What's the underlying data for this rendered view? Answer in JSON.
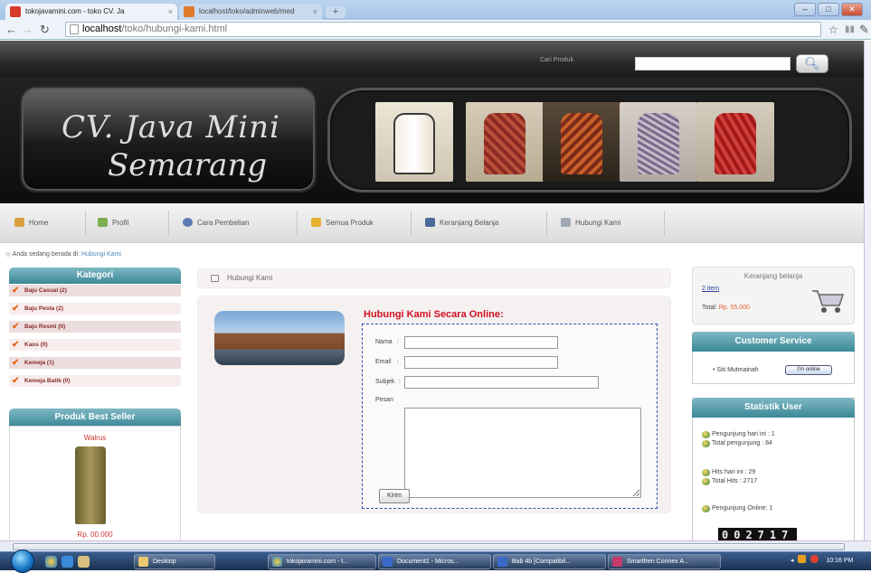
{
  "browser": {
    "tabs": [
      {
        "label": "tokojavamini.com - toko CV. Jа"
      },
      {
        "label": "localhost/toko/adminweb/med"
      }
    ],
    "url_host": "localhost",
    "url_path": "/toko/hubungi-kami.html",
    "new_tab": "+",
    "win_min": "–",
    "win_max": "□",
    "win_close": "✕"
  },
  "header": {
    "search_label": "Cari Produk",
    "search_value": "",
    "logo_line1": "CV. Java Mini",
    "logo_line2": "Semarang"
  },
  "nav": {
    "items": [
      {
        "label": "Home",
        "icon": "home-icon"
      },
      {
        "label": "Profil",
        "icon": "profile-icon"
      },
      {
        "label": "Cara Pembelian",
        "icon": "help-icon"
      },
      {
        "label": "Semua Produk",
        "icon": "star-icon"
      },
      {
        "label": "Keranjang Belanja",
        "icon": "cart-icon"
      },
      {
        "label": "Hubungi Kami",
        "icon": "contact-icon"
      }
    ]
  },
  "breadcrumb": {
    "prefix": "Anda sedang berada di:",
    "current": "Hubungi Kami"
  },
  "left": {
    "kategori_title": "Kategori",
    "categories": [
      "Baju Casual (2)",
      "Baju Pesta (2)",
      "Baju Resmi (0)",
      "Kaos (0)",
      "Kemeja (1)",
      "Kemeja Batik (0)"
    ],
    "best_title": "Produk Best Seller",
    "best_name": "Walrus",
    "best_price": "Rp. 00.000"
  },
  "main": {
    "head": "Hubungi Kami",
    "form_title": "Hubungi Kami Secara Online:",
    "labels": {
      "nama": "Nama",
      "email": "Email",
      "subjek": "Subjek",
      "pesan": "Pesan"
    },
    "values": {
      "nama": "",
      "email": "",
      "subjek": "",
      "pesan": ""
    },
    "submit": "Kirim"
  },
  "right": {
    "cart_title": "Keranjang belanja",
    "cart_item": "2 item",
    "cart_total_label": "Total:",
    "cart_total_value": "Rp. 55.000",
    "cs_title": "Customer Service",
    "cs_name": "• Siti Mutmainah",
    "cs_status": "I'm online",
    "stat_title": "Statistik User",
    "stats": [
      "Pengunjung hari ini : 1",
      "Total pengunjung : 84",
      "Hits hari ini : 29",
      "Total Hits : 2717",
      "Pengunjung Online: 1"
    ],
    "counter": "002717"
  },
  "taskbar": {
    "tasks": [
      "Desktop",
      "tokojavamini.com - t...",
      "Document1 - Micros...",
      "Bab 4b [Compatibil...",
      "Smartfren Connex A..."
    ],
    "clock": "10:16 PM"
  }
}
